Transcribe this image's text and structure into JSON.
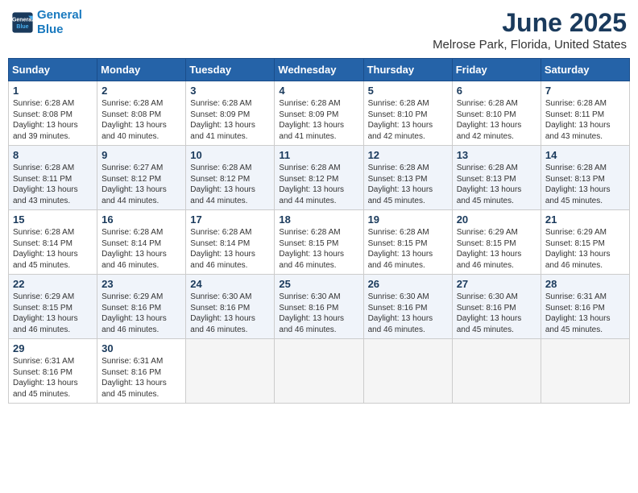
{
  "header": {
    "logo_line1": "General",
    "logo_line2": "Blue",
    "title": "June 2025",
    "subtitle": "Melrose Park, Florida, United States"
  },
  "weekdays": [
    "Sunday",
    "Monday",
    "Tuesday",
    "Wednesday",
    "Thursday",
    "Friday",
    "Saturday"
  ],
  "weeks": [
    [
      {
        "day": "1",
        "sunrise": "6:28 AM",
        "sunset": "8:08 PM",
        "daylight": "13 hours and 39 minutes."
      },
      {
        "day": "2",
        "sunrise": "6:28 AM",
        "sunset": "8:08 PM",
        "daylight": "13 hours and 40 minutes."
      },
      {
        "day": "3",
        "sunrise": "6:28 AM",
        "sunset": "8:09 PM",
        "daylight": "13 hours and 41 minutes."
      },
      {
        "day": "4",
        "sunrise": "6:28 AM",
        "sunset": "8:09 PM",
        "daylight": "13 hours and 41 minutes."
      },
      {
        "day": "5",
        "sunrise": "6:28 AM",
        "sunset": "8:10 PM",
        "daylight": "13 hours and 42 minutes."
      },
      {
        "day": "6",
        "sunrise": "6:28 AM",
        "sunset": "8:10 PM",
        "daylight": "13 hours and 42 minutes."
      },
      {
        "day": "7",
        "sunrise": "6:28 AM",
        "sunset": "8:11 PM",
        "daylight": "13 hours and 43 minutes."
      }
    ],
    [
      {
        "day": "8",
        "sunrise": "6:28 AM",
        "sunset": "8:11 PM",
        "daylight": "13 hours and 43 minutes."
      },
      {
        "day": "9",
        "sunrise": "6:27 AM",
        "sunset": "8:12 PM",
        "daylight": "13 hours and 44 minutes."
      },
      {
        "day": "10",
        "sunrise": "6:28 AM",
        "sunset": "8:12 PM",
        "daylight": "13 hours and 44 minutes."
      },
      {
        "day": "11",
        "sunrise": "6:28 AM",
        "sunset": "8:12 PM",
        "daylight": "13 hours and 44 minutes."
      },
      {
        "day": "12",
        "sunrise": "6:28 AM",
        "sunset": "8:13 PM",
        "daylight": "13 hours and 45 minutes."
      },
      {
        "day": "13",
        "sunrise": "6:28 AM",
        "sunset": "8:13 PM",
        "daylight": "13 hours and 45 minutes."
      },
      {
        "day": "14",
        "sunrise": "6:28 AM",
        "sunset": "8:13 PM",
        "daylight": "13 hours and 45 minutes."
      }
    ],
    [
      {
        "day": "15",
        "sunrise": "6:28 AM",
        "sunset": "8:14 PM",
        "daylight": "13 hours and 45 minutes."
      },
      {
        "day": "16",
        "sunrise": "6:28 AM",
        "sunset": "8:14 PM",
        "daylight": "13 hours and 46 minutes."
      },
      {
        "day": "17",
        "sunrise": "6:28 AM",
        "sunset": "8:14 PM",
        "daylight": "13 hours and 46 minutes."
      },
      {
        "day": "18",
        "sunrise": "6:28 AM",
        "sunset": "8:15 PM",
        "daylight": "13 hours and 46 minutes."
      },
      {
        "day": "19",
        "sunrise": "6:28 AM",
        "sunset": "8:15 PM",
        "daylight": "13 hours and 46 minutes."
      },
      {
        "day": "20",
        "sunrise": "6:29 AM",
        "sunset": "8:15 PM",
        "daylight": "13 hours and 46 minutes."
      },
      {
        "day": "21",
        "sunrise": "6:29 AM",
        "sunset": "8:15 PM",
        "daylight": "13 hours and 46 minutes."
      }
    ],
    [
      {
        "day": "22",
        "sunrise": "6:29 AM",
        "sunset": "8:15 PM",
        "daylight": "13 hours and 46 minutes."
      },
      {
        "day": "23",
        "sunrise": "6:29 AM",
        "sunset": "8:16 PM",
        "daylight": "13 hours and 46 minutes."
      },
      {
        "day": "24",
        "sunrise": "6:30 AM",
        "sunset": "8:16 PM",
        "daylight": "13 hours and 46 minutes."
      },
      {
        "day": "25",
        "sunrise": "6:30 AM",
        "sunset": "8:16 PM",
        "daylight": "13 hours and 46 minutes."
      },
      {
        "day": "26",
        "sunrise": "6:30 AM",
        "sunset": "8:16 PM",
        "daylight": "13 hours and 46 minutes."
      },
      {
        "day": "27",
        "sunrise": "6:30 AM",
        "sunset": "8:16 PM",
        "daylight": "13 hours and 45 minutes."
      },
      {
        "day": "28",
        "sunrise": "6:31 AM",
        "sunset": "8:16 PM",
        "daylight": "13 hours and 45 minutes."
      }
    ],
    [
      {
        "day": "29",
        "sunrise": "6:31 AM",
        "sunset": "8:16 PM",
        "daylight": "13 hours and 45 minutes."
      },
      {
        "day": "30",
        "sunrise": "6:31 AM",
        "sunset": "8:16 PM",
        "daylight": "13 hours and 45 minutes."
      },
      null,
      null,
      null,
      null,
      null
    ]
  ],
  "labels": {
    "sunrise": "Sunrise:",
    "sunset": "Sunset:",
    "daylight": "Daylight:"
  }
}
